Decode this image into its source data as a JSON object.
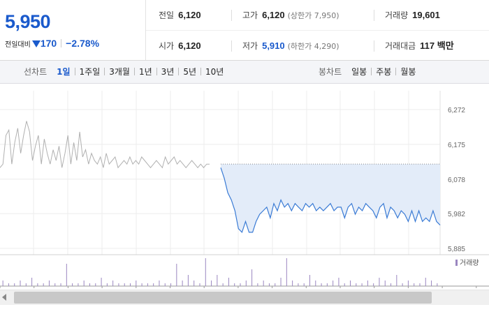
{
  "price": {
    "current": "5,950",
    "change_label": "전일대비",
    "change_value": "170",
    "change_pct": "−2.78%"
  },
  "quotes": {
    "row1": [
      {
        "label": "전일",
        "value": "6,120",
        "sub": ""
      },
      {
        "label": "고가",
        "value": "6,120",
        "sub": "(상한가 7,950)"
      },
      {
        "label": "거래량",
        "value": "19,601",
        "sub": ""
      }
    ],
    "row2": [
      {
        "label": "시가",
        "value": "6,120",
        "sub": ""
      },
      {
        "label": "저가",
        "value": "5,910",
        "sub": "(하한가 4,290)"
      },
      {
        "label": "거래대금",
        "value": "117 백만",
        "sub": ""
      }
    ]
  },
  "tabs": {
    "line_label": "선차트",
    "line_tabs": [
      "1일",
      "1주일",
      "3개월",
      "1년",
      "3년",
      "5년",
      "10년"
    ],
    "line_active": 0,
    "candle_label": "봉차트",
    "candle_tabs": [
      "일봉",
      "주봉",
      "월봉"
    ]
  },
  "chart_data": {
    "type": "line",
    "y_ticks": [
      "6,272",
      "6,175",
      "6,078",
      "5,982",
      "5,885"
    ],
    "y_tick_values": [
      6272,
      6175,
      6078,
      5982,
      5885
    ],
    "ylim": [
      5885,
      6272
    ],
    "reference_line": 6120,
    "volume_legend": "거래량",
    "colors": {
      "prev_session": "#b0b0b0",
      "current": "#3a7bd5",
      "fill": "#e3ecf9",
      "volume": "#9a86c0"
    },
    "series": [
      {
        "values": [
          6110,
          6120,
          6200,
          6215,
          6120,
          6180,
          6220,
          6150,
          6200,
          6240,
          6210,
          6130,
          6170,
          6200,
          6120,
          6190,
          6150,
          6120,
          6160,
          6130,
          6170,
          6110,
          6150,
          6200,
          6120,
          6180,
          6130,
          6210,
          6140,
          6160,
          6120,
          6150,
          6130,
          6120,
          6140,
          6110,
          6150,
          6120,
          6130,
          6140,
          6110,
          6120,
          6130,
          6120,
          6140,
          6120,
          6130,
          6120,
          6140,
          6130,
          6120,
          6110,
          6120,
          6130,
          6120,
          6110,
          6140,
          6120,
          6130,
          6140,
          6120,
          6130,
          6120,
          6110,
          6120,
          6130,
          6120,
          6110,
          6120,
          6110,
          6120,
          6120
        ]
      },
      {
        "values": [
          6110,
          6080,
          6040,
          6020,
          5990,
          5940,
          5930,
          5960,
          5930,
          5930,
          5960,
          5980,
          5990,
          6000,
          5970,
          6010,
          5990,
          6020,
          6000,
          6010,
          5990,
          6010,
          6000,
          5990,
          6010,
          6000,
          6010,
          5990,
          6000,
          5990,
          6000,
          6010,
          5990,
          6000,
          6000,
          5970,
          6000,
          6010,
          5980,
          6000,
          5990,
          6010,
          6000,
          5990,
          5970,
          6000,
          6010,
          5970,
          6000,
          5990,
          5970,
          5990,
          5980,
          5960,
          5990,
          5960,
          5990,
          5960,
          5970,
          5960,
          5990,
          5960,
          5950
        ]
      }
    ],
    "volume": [
      2,
      1,
      1,
      2,
      1,
      3,
      1,
      1,
      2,
      1,
      1,
      8,
      1,
      1,
      2,
      1,
      1,
      3,
      1,
      2,
      1,
      1,
      1,
      2,
      1,
      1,
      1,
      2,
      1,
      1,
      8,
      2,
      4,
      2,
      1,
      10,
      2,
      4,
      1,
      3,
      1,
      1,
      2,
      6,
      1,
      2,
      1,
      1,
      3,
      10,
      2,
      1,
      1,
      4,
      2,
      1,
      1,
      2,
      3,
      1,
      2,
      1,
      1,
      2,
      1,
      3,
      2,
      1,
      4,
      1,
      2,
      1,
      1,
      3,
      2,
      1
    ]
  },
  "scrollbar": {
    "left_arrow": "◀"
  }
}
